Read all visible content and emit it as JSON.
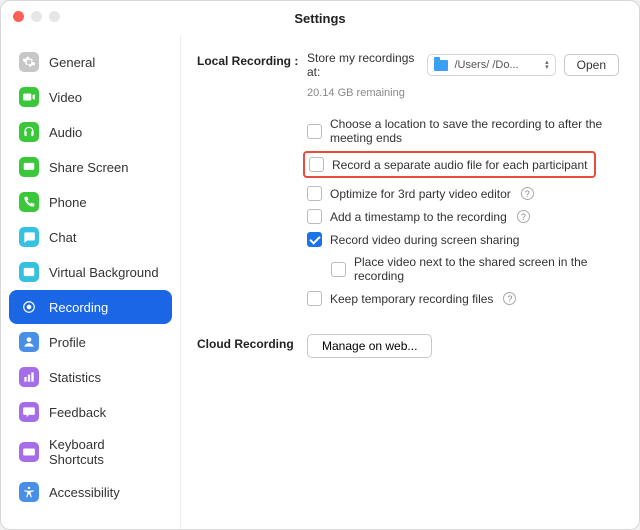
{
  "window": {
    "title": "Settings"
  },
  "sidebar": {
    "items": [
      {
        "label": "General",
        "active": false,
        "icon": "gear",
        "color": "#c7c7c7"
      },
      {
        "label": "Video",
        "active": false,
        "icon": "video",
        "color": "#3ac73a"
      },
      {
        "label": "Audio",
        "active": false,
        "icon": "headphones",
        "color": "#3ac73a"
      },
      {
        "label": "Share Screen",
        "active": false,
        "icon": "share",
        "color": "#3ac73a"
      },
      {
        "label": "Phone",
        "active": false,
        "icon": "phone",
        "color": "#3ac73a"
      },
      {
        "label": "Chat",
        "active": false,
        "icon": "chat",
        "color": "#35c1e0"
      },
      {
        "label": "Virtual Background",
        "active": false,
        "icon": "virtual-bg",
        "color": "#35c1e0"
      },
      {
        "label": "Recording",
        "active": true,
        "icon": "record",
        "color": "#ffffff"
      },
      {
        "label": "Profile",
        "active": false,
        "icon": "profile",
        "color": "#4a8fe7"
      },
      {
        "label": "Statistics",
        "active": false,
        "icon": "stats",
        "color": "#a56de8"
      },
      {
        "label": "Feedback",
        "active": false,
        "icon": "feedback",
        "color": "#a56de8"
      },
      {
        "label": "Keyboard Shortcuts",
        "active": false,
        "icon": "keyboard",
        "color": "#a56de8"
      },
      {
        "label": "Accessibility",
        "active": false,
        "icon": "accessibility",
        "color": "#4a8fe7"
      }
    ]
  },
  "local_recording": {
    "section_label": "Local Recording :",
    "store_label": "Store my recordings at:",
    "path_display": "/Users/            /Do...",
    "open_button": "Open",
    "remaining": "20.14 GB remaining",
    "options": [
      {
        "label": "Choose a location to save the recording to after the meeting ends",
        "checked": false,
        "help": false,
        "highlight": false
      },
      {
        "label": "Record a separate audio file for each participant",
        "checked": false,
        "help": false,
        "highlight": true
      },
      {
        "label": "Optimize for 3rd party video editor",
        "checked": false,
        "help": true,
        "highlight": false
      },
      {
        "label": "Add a timestamp to the recording",
        "checked": false,
        "help": true,
        "highlight": false
      },
      {
        "label": "Record video during screen sharing",
        "checked": true,
        "help": false,
        "highlight": false
      },
      {
        "label": "Place video next to the shared screen in the recording",
        "checked": false,
        "help": false,
        "highlight": false,
        "nested": true
      },
      {
        "label": "Keep temporary recording files",
        "checked": false,
        "help": true,
        "highlight": false
      }
    ]
  },
  "cloud_recording": {
    "section_label": "Cloud Recording",
    "manage_button": "Manage on web..."
  }
}
